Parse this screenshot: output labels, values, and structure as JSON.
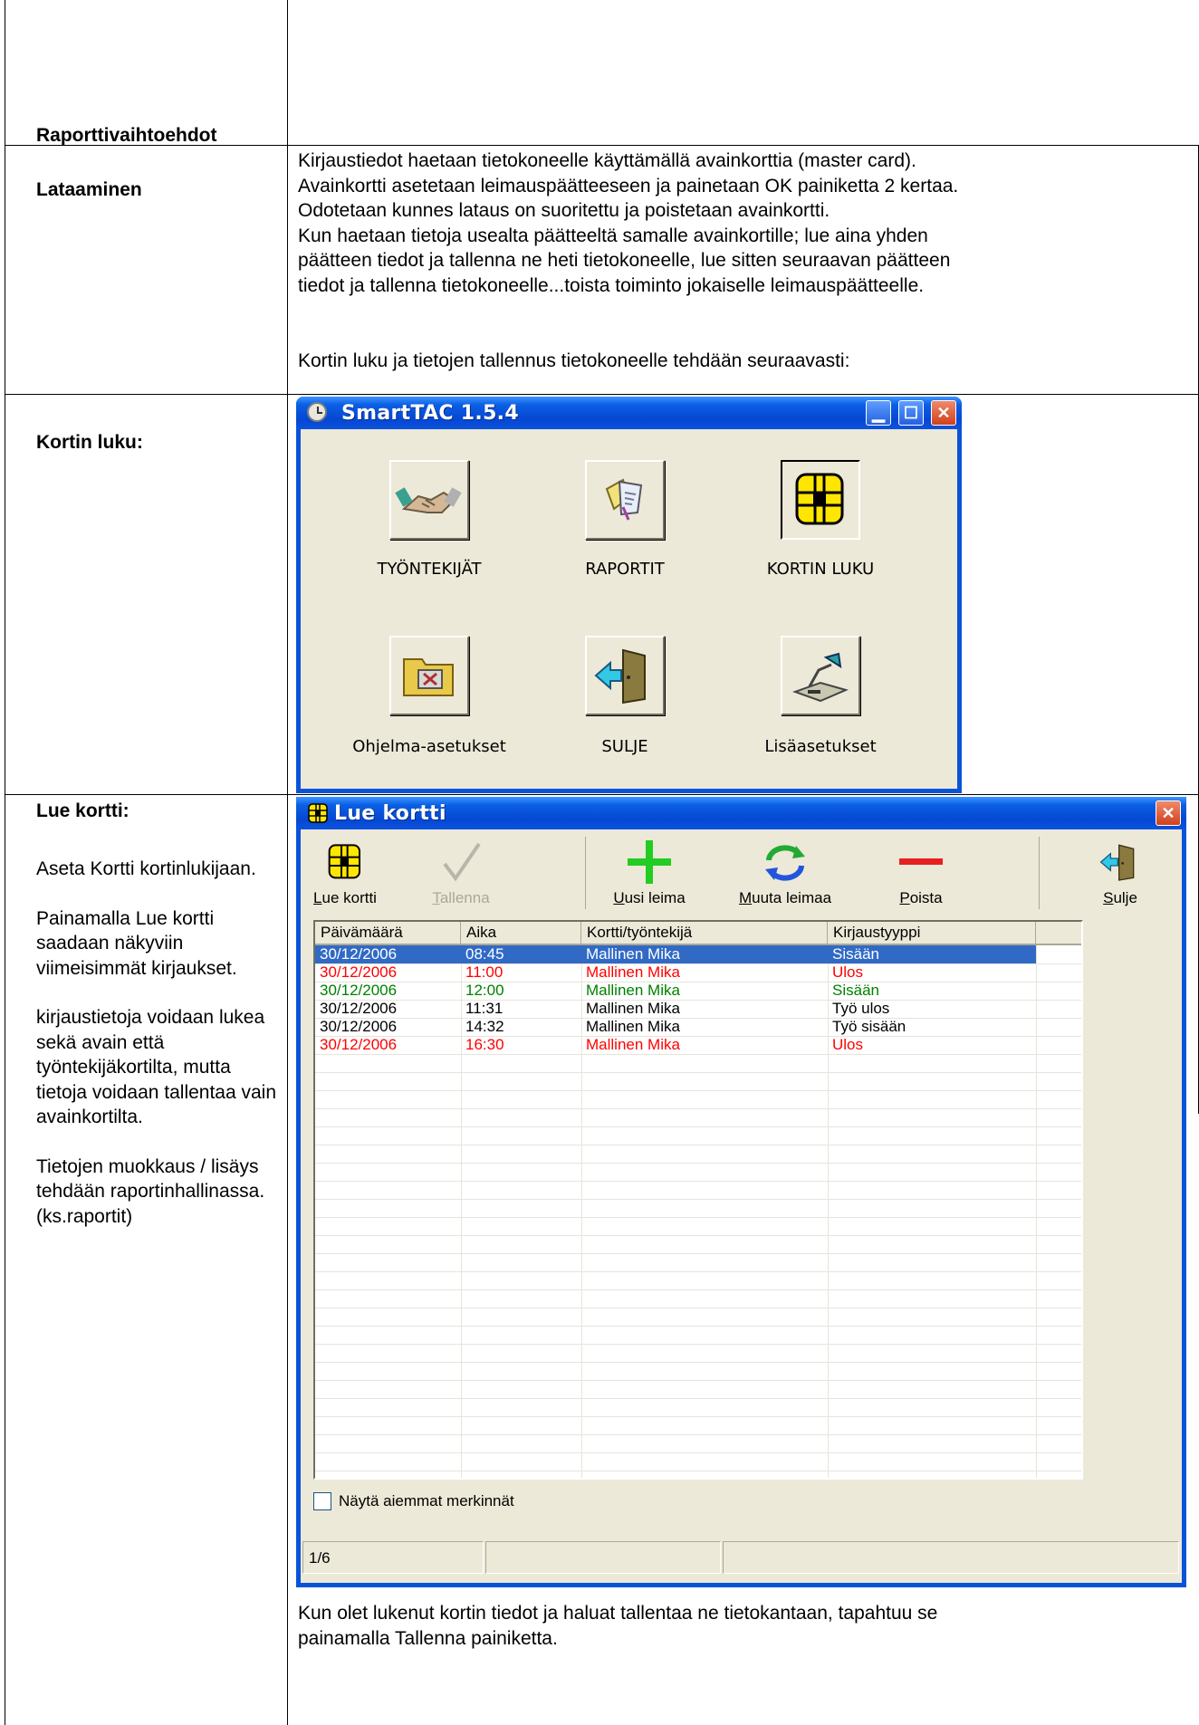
{
  "rows": {
    "reports": {
      "label": "Raporttivaihtoehdot"
    },
    "loading": {
      "label": "Lataaminen",
      "text": "Kirjaustiedot haetaan tietokoneelle käyttämällä avainkorttia (master card).\nAvainkortti asetetaan leimauspäätteeseen ja painetaan OK painiketta 2 kertaa.\nOdotetaan kunnes lataus on suoritettu ja poistetaan avainkortti.\nKun haetaan tietoja usealta päätteeltä samalle avainkortille; lue aina yhden\npäätteen tiedot ja tallenna ne heti tietokoneelle, lue sitten seuraavan päätteen\ntiedot ja tallenna tietokoneelle...toista toiminto jokaiselle leimauspäätteelle.",
      "text2": "Kortin luku ja tietojen tallennus tietokoneelle tehdään seuraavasti:"
    },
    "card_read": {
      "label": "Kortin luku:"
    },
    "read_card": {
      "label": "Lue kortti:",
      "paragraphs": [
        "Aseta Kortti kortinlukijaan.",
        "Painamalla Lue kortti saadaan näkyviin viimeisimmät kirjaukset.",
        "kirjaustietoja voidaan lukea sekä avain että työntekijäkortilta, mutta tietoja voidaan tallentaa vain avainkortilta.",
        "Tietojen muokkaus / lisäys tehdään raportinhallinassa. (ks.raportit)"
      ],
      "footer_text": "Kun olet lukenut kortin tiedot ja haluat tallentaa ne tietokantaan, tapahtuu se\npainamalla Tallenna painiketta."
    }
  },
  "smarttac_window": {
    "title": "SmartTAC 1.5.4",
    "buttons": [
      {
        "label": "TYÖNTEKIJÄT",
        "icon": "handshake-icon"
      },
      {
        "label": "RAPORTIT",
        "icon": "report-icon"
      },
      {
        "label": "KORTIN LUKU",
        "icon": "smartcard-chip-icon"
      },
      {
        "label": "Ohjelma-asetukset",
        "icon": "settings-folder-icon"
      },
      {
        "label": "SULJE",
        "icon": "exit-door-icon"
      },
      {
        "label": "Lisäasetukset",
        "icon": "desk-lamp-icon"
      }
    ]
  },
  "lue_kortti_window": {
    "title": "Lue kortti",
    "toolbar": [
      {
        "key": "L",
        "rest": "ue kortti",
        "enabled": true,
        "icon": "smartcard-chip-icon"
      },
      {
        "key": "T",
        "rest": "allenna",
        "enabled": false,
        "icon": "checkmark-icon"
      },
      {
        "key": "U",
        "rest": "usi leima",
        "enabled": true,
        "icon": "plus-icon"
      },
      {
        "key": "M",
        "rest": "uuta leimaa",
        "enabled": true,
        "icon": "refresh-arrows-icon"
      },
      {
        "key": "P",
        "rest": "oista",
        "enabled": true,
        "icon": "minus-icon"
      },
      {
        "key": "S",
        "rest": "ulje",
        "enabled": true,
        "icon": "exit-door-icon"
      }
    ],
    "columns": [
      "Päivämäärä",
      "Aika",
      "Kortti/työntekijä",
      "Kirjaustyyppi"
    ],
    "rows": [
      {
        "date": "30/12/2006",
        "time": "08:45",
        "name": "Mallinen Mika",
        "type": "Sisään",
        "color": "#ffffff",
        "selected": true
      },
      {
        "date": "30/12/2006",
        "time": "11:00",
        "name": "Mallinen Mika",
        "type": "Ulos",
        "color": "#ff0000",
        "selected": false
      },
      {
        "date": "30/12/2006",
        "time": "12:00",
        "name": "Mallinen Mika",
        "type": "Sisään",
        "color": "#008000",
        "selected": false
      },
      {
        "date": "30/12/2006",
        "time": "11:31",
        "name": "Mallinen Mika",
        "type": "Työ ulos",
        "color": "#000000",
        "selected": false
      },
      {
        "date": "30/12/2006",
        "time": "14:32",
        "name": "Mallinen Mika",
        "type": "Työ sisään",
        "color": "#000000",
        "selected": false
      },
      {
        "date": "30/12/2006",
        "time": "16:30",
        "name": "Mallinen Mika",
        "type": "Ulos",
        "color": "#ff0000",
        "selected": false
      }
    ],
    "checkbox_label": "Näytä aiemmat merkinnät",
    "status": "1/6"
  }
}
